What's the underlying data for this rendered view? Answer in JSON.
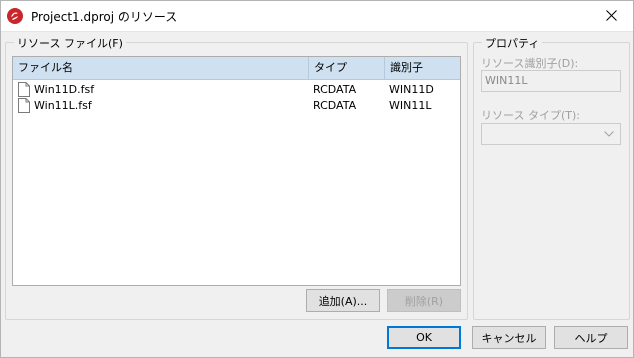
{
  "window": {
    "title": "Project1.dproj のリソース",
    "close_icon": "close-icon",
    "app_icon": "delphi-app-icon"
  },
  "resource_files": {
    "legend": "リソース ファイル(F)",
    "columns": [
      "ファイル名",
      "タイプ",
      "識別子"
    ],
    "rows": [
      {
        "file": "Win11D.fsf",
        "type": "RCDATA",
        "id": "WIN11D",
        "icon": "file-icon"
      },
      {
        "file": "Win11L.fsf",
        "type": "RCDATA",
        "id": "WIN11L",
        "icon": "file-icon"
      }
    ],
    "add_button": "追加(A)...",
    "remove_button": "削除(R)"
  },
  "properties": {
    "legend": "プロパティ",
    "id_label": "リソース識別子(D):",
    "id_value": "WIN11L",
    "type_label": "リソース タイプ(T):",
    "type_value": ""
  },
  "footer": {
    "ok": "OK",
    "cancel": "キャンセル",
    "help": "ヘルプ"
  },
  "colors": {
    "accent": "#0078d7",
    "header_bg": "#cfe0f1",
    "app_icon_red": "#c8262c"
  }
}
